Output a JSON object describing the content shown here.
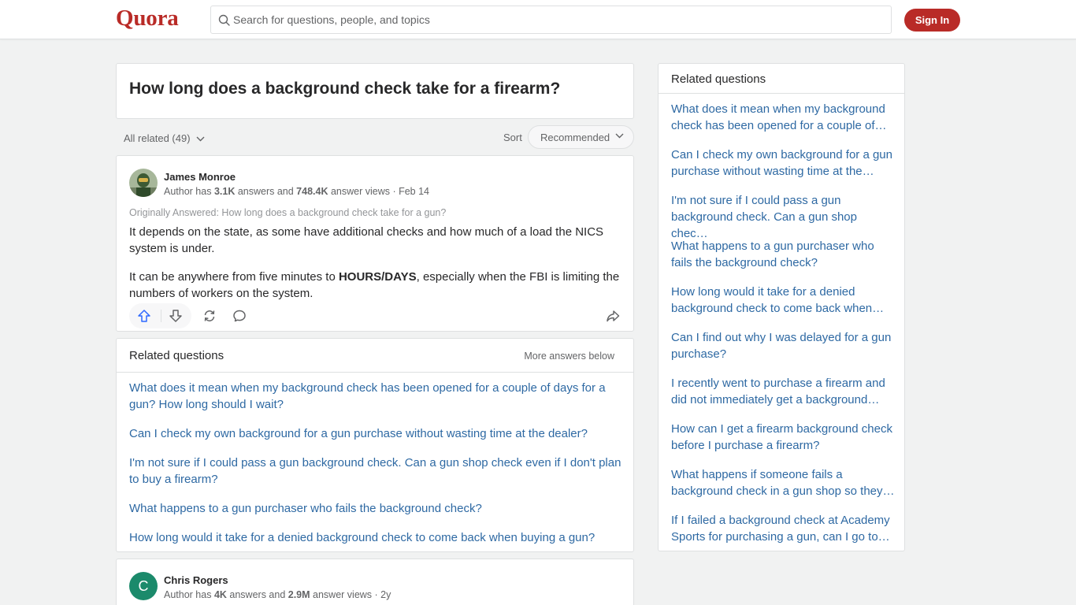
{
  "header": {
    "logo": "Quora",
    "search_placeholder": "Search for questions, people, and topics",
    "signin_label": "Sign In"
  },
  "question": {
    "title": "How long does a background check take for a firearm?"
  },
  "filters": {
    "all_related": "All related (49)",
    "sort_label": "Sort",
    "sort_value": "Recommended"
  },
  "answer1": {
    "author": "James Monroe",
    "meta_prefix": "Author has ",
    "answers_count": "3.1K",
    "meta_mid": " answers and ",
    "views_count": "748.4K",
    "meta_suffix": " answer views · Feb 14",
    "originally_answered": "Originally Answered: How long does a background check take for a gun?",
    "para1": "It depends on the state, as some have additional checks and how much of a load the NICS system is under.",
    "para2_before": "It can be anywhere from five minutes to ",
    "para2_bold": "HOURS/DAYS",
    "para2_after": ", especially when the FBI is limiting the numbers of workers on the system."
  },
  "related_main": {
    "title": "Related questions",
    "more_below": "More answers below",
    "items": [
      "What does it mean when my background check has been opened for a couple of days for a gun? How long should I wait?",
      "Can I check my own background for a gun purchase without wasting time at the dealer?",
      "I'm not sure if I could pass a gun background check. Can a gun shop check even if I don't plan to buy a firearm?",
      "What happens to a gun purchaser who fails the background check?",
      "How long would it take for a denied background check to come back when buying a gun?"
    ]
  },
  "answer2": {
    "avatar_letter": "C",
    "author": "Chris Rogers",
    "meta_prefix": "Author has ",
    "answers_count": "4K",
    "meta_mid": " answers and ",
    "views_count": "2.9M",
    "meta_suffix": " answer views · 2y"
  },
  "sidebar": {
    "title": "Related questions",
    "items": [
      "What does it mean when my background check has been opened for a couple of…",
      "Can I check my own background for a gun purchase without wasting time at the…",
      "I'm not sure if I could pass a gun background check. Can a gun shop chec…",
      "What happens to a gun purchaser who fails the background check?",
      "How long would it take for a denied background check to come back when…",
      "Can I find out why I was delayed for a gun purchase?",
      "I recently went to purchase a firearm and did not immediately get a background…",
      "How can I get a firearm background check before I purchase a firearm?",
      "What happens if someone fails a background check in a gun shop so they…",
      "If I failed a background check at Academy Sports for purchasing a gun, can I go to…"
    ]
  },
  "colors": {
    "brand": "#b92b27",
    "link": "#2e69a3",
    "upvote": "#2e69ff"
  }
}
